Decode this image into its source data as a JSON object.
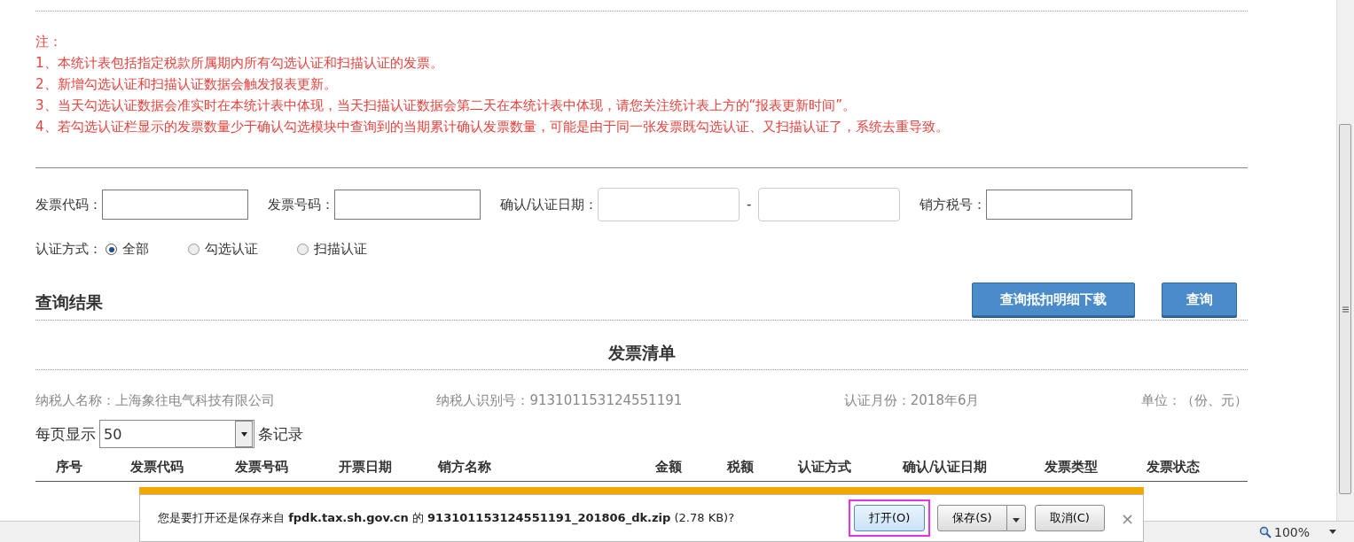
{
  "notes": {
    "title": "注：",
    "lines": [
      "1、本统计表包括指定税款所属期内所有勾选认证和扫描认证的发票。",
      "2、新增勾选认证和扫描认证数据会触发报表更新。",
      "3、当天勾选认证数据会准实时在本统计表中体现，当天扫描认证数据会第二天在本统计表中体现，请您关注统计表上方的“报表更新时间”。",
      "4、若勾选认证栏显示的发票数量少于确认勾选模块中查询到的当期累计确认发票数量，可能是由于同一张发票既勾选认证、又扫描认证了，系统去重导致。"
    ]
  },
  "filters": [
    {
      "label": "发票代码：",
      "kind": "text"
    },
    {
      "label": "发票号码：",
      "kind": "text"
    },
    {
      "label": "确认/认证日期：",
      "kind": "date-range",
      "separator": "-"
    },
    {
      "label": "销方税号：",
      "kind": "text"
    }
  ],
  "auth_method": {
    "label": "认证方式：",
    "options": [
      {
        "label": "全部",
        "selected": true
      },
      {
        "label": "勾选认证",
        "selected": false
      },
      {
        "label": "扫描认证",
        "selected": false
      }
    ]
  },
  "results": {
    "title": "查询结果",
    "buttons": [
      "查询抵扣明细下载",
      "查询"
    ]
  },
  "invoice_list": {
    "title": "发票清单",
    "info": [
      "纳税人名称：上海象往电气科技有限公司",
      "纳税人识别号：913101153124551191",
      "认证月份：2018年6月",
      "单位：（份、元）"
    ],
    "page_size": {
      "prefix": "每页显示",
      "value": "50",
      "suffix": "条记录"
    },
    "columns": [
      "序号",
      "发票代码",
      "发票号码",
      "开票日期",
      "销方名称",
      "金额",
      "税额",
      "认证方式",
      "确认/认证日期",
      "发票类型",
      "发票状态"
    ]
  },
  "download_bar": {
    "message": "您是要打开还是保存来自 **fpdk.tax.sh.gov.cn** 的 **913101153124551191_201806_dk.zip** (2.78 KB)?",
    "buttons": [
      {
        "label": "打开(O)",
        "kind": "plain",
        "highlighted": true
      },
      {
        "label": "保存(S)",
        "kind": "split",
        "highlighted": false
      },
      {
        "label": "取消(C)",
        "kind": "plain",
        "highlighted": false
      }
    ],
    "close": "×"
  },
  "status_bar": {
    "zoom": "100%"
  }
}
